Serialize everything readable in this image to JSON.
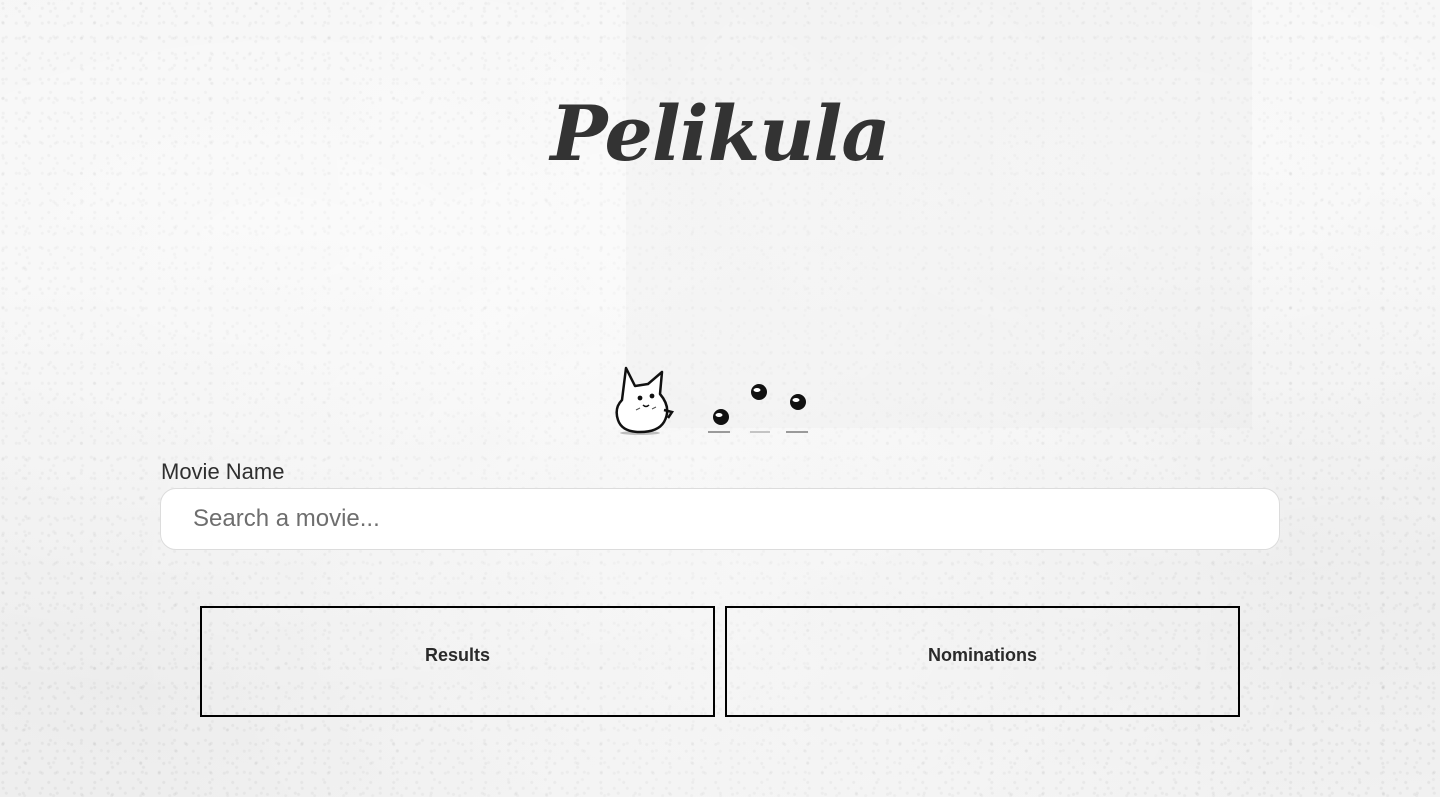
{
  "app": {
    "title": "Pelikula"
  },
  "search": {
    "label": "Movie Name",
    "placeholder": "Search a movie...",
    "value": ""
  },
  "panels": {
    "results": {
      "heading": "Results"
    },
    "nominations": {
      "heading": "Nominations"
    }
  },
  "decoration": {
    "illustration": "cat-with-bouncing-balls-icon"
  },
  "colors": {
    "title": "#333333",
    "panel_border": "#000000",
    "input_border": "#dcdcdc",
    "background": "#f4f4f4"
  }
}
